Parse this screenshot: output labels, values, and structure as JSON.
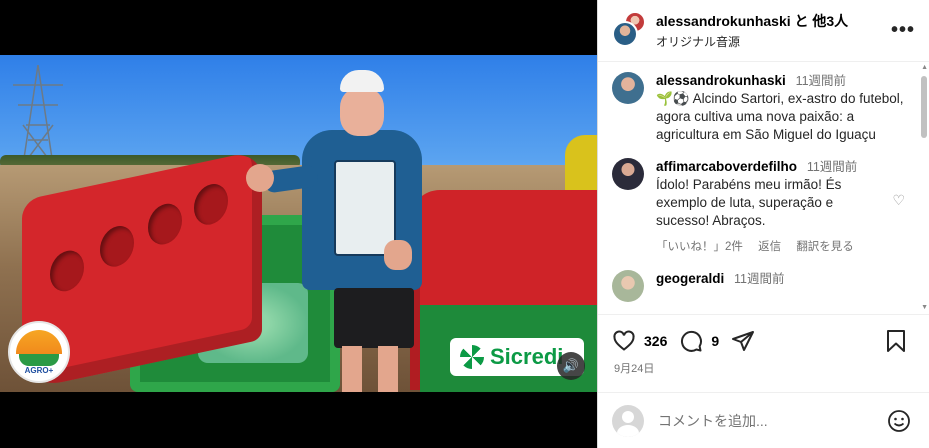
{
  "header": {
    "title": "alessandrokunhaski と 他3人",
    "subtitle": "オリジナル音源"
  },
  "media": {
    "sponsor_name": "Sicredi",
    "logo_text": "AGRO+"
  },
  "comments": [
    {
      "username": "alessandrokunhaski",
      "time": "11週間前",
      "text": "🌱⚽ Alcindo Sartori, ex-astro do futebol, agora cultiva uma nova paixão: a agricultura em São Miguel do Iguaçu",
      "avatar_color": "#3f6f8f"
    },
    {
      "username": "affimarcaboverdefilho",
      "time": "11週間前",
      "text": "Ídolo! Parabéns meu irmão! És exemplo de luta, superação e sucesso! Abraços.",
      "likes_label": "「いいね！」2件",
      "reply_label": "返信",
      "translate_label": "翻訳を見る",
      "avatar_color": "#2b2b3a"
    },
    {
      "username": "geogeraldi",
      "time": "11週間前",
      "text": "",
      "avatar_color": "#a8b79a"
    }
  ],
  "toolbar": {
    "likes_count": "326",
    "comments_count": "9"
  },
  "post_date": "9月24日",
  "composer": {
    "placeholder": "コメントを追加..."
  },
  "colors": {
    "brand_green": "#0c9a45",
    "muted_text": "#737373"
  }
}
